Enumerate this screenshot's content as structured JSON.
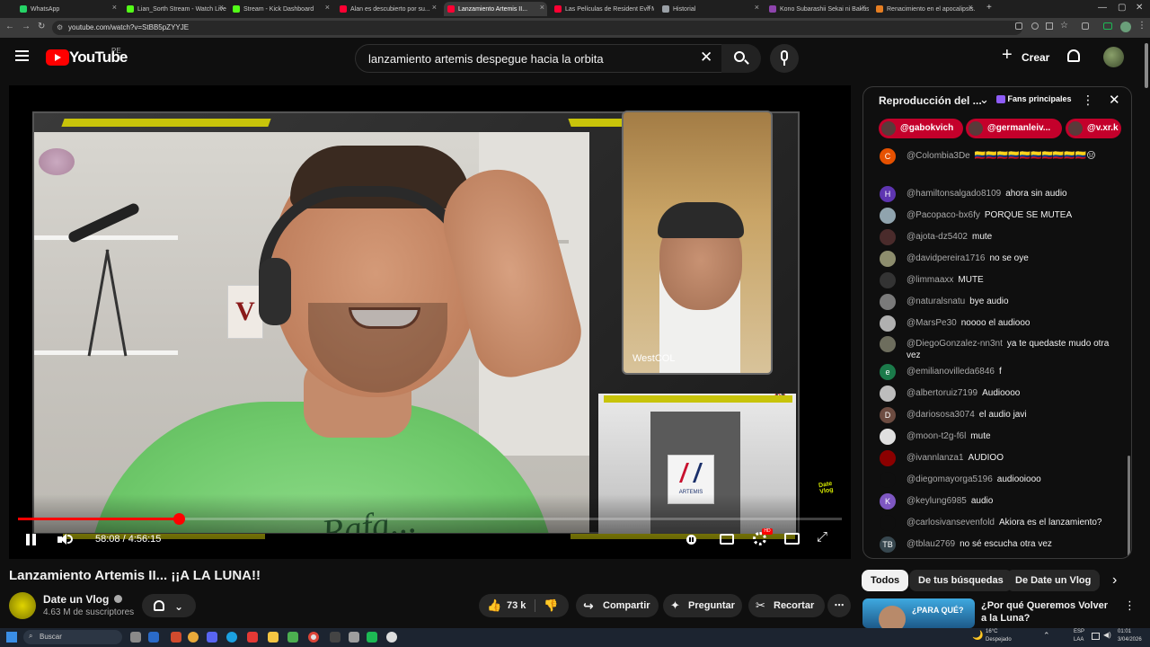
{
  "browser": {
    "tabs": [
      {
        "title": "WhatsApp",
        "color": "#25d366",
        "active": false
      },
      {
        "title": "Lian_Sorth Stream - Watch Live...",
        "color": "#53fc18",
        "active": false
      },
      {
        "title": "Stream - Kick Dashboard",
        "color": "#53fc18",
        "active": false
      },
      {
        "title": "Alan es descubierto por su...",
        "color": "#ff0033",
        "active": false
      },
      {
        "title": "Lanzamiento Artemis II...",
        "color": "#ff0033",
        "active": true
      },
      {
        "title": "Las Películas de Resident Evil M...",
        "color": "#ff0033",
        "active": false
      },
      {
        "title": "Historial",
        "color": "#9aa0a6",
        "active": false
      },
      {
        "title": "Kono Subarashii Sekai ni Bakus...",
        "color": "#8e44ad",
        "active": false
      },
      {
        "title": "Renacimiento en el apocalipsis...",
        "color": "#e67e22",
        "active": false
      }
    ],
    "url": "youtube.com/watch?v=StBB5pZYYJE"
  },
  "header": {
    "logo_text": "YouTube",
    "country": "PE",
    "search_value": "lanzamiento artemis despegue hacia la orbita",
    "create_label": "Crear"
  },
  "player": {
    "time_current": "58:08",
    "time_separator": "/",
    "time_total": "4:56:15",
    "progress_fraction": 0.195,
    "guest_name": "WestCOL",
    "sign_text": "ARTEMIS"
  },
  "video": {
    "title": "Lanzamiento Artemis II... ¡¡A LA LUNA!!",
    "channel": "Date un Vlog",
    "subscribers": "4.63 M de suscriptores",
    "likes": "73 k",
    "share_label": "Compartir",
    "ask_label": "Preguntar",
    "clip_label": "Recortar"
  },
  "chat": {
    "title": "Reproducción del ...",
    "badge": "Fans principales",
    "pinned": [
      "@gabokvich",
      "@germanleiv...",
      "@v.xr.k"
    ],
    "messages": [
      {
        "author": "@Colombia3De",
        "text": "🇨🇴🇨🇴🇨🇴🇨🇴🇨🇴🇨🇴🇨🇴🇨🇴🇨🇴🇨🇴😑",
        "initial": "C",
        "color": "#e65100"
      },
      {
        "author": "@hamiltonsalgado8109",
        "text": "ahora sin audio",
        "initial": "H",
        "color": "#5e35b1"
      },
      {
        "author": "@Pacopaco-bx6fy",
        "text": "PORQUE SE MUTEA",
        "initial": "",
        "color": "#90a4ae"
      },
      {
        "author": "@ajota-dz5402",
        "text": "mute",
        "initial": "",
        "color": "#4a2b2b"
      },
      {
        "author": "@davidpereira1716",
        "text": "no se oye",
        "initial": "",
        "color": "#8d8d6d"
      },
      {
        "author": "@limmaaxx",
        "text": "MUTE",
        "initial": "",
        "color": "#333333"
      },
      {
        "author": "@naturalsnatu",
        "text": "bye audio",
        "initial": "",
        "color": "#7a7a7a"
      },
      {
        "author": "@MarsPe30",
        "text": "noooo el audiooo",
        "initial": "",
        "color": "#b0b0b0"
      },
      {
        "author": "@DiegoGonzalez-nn3nt",
        "text": "ya te quedaste mudo otra vez",
        "initial": "",
        "color": "#6d6d5d"
      },
      {
        "author": "@emilianovilleda6846",
        "text": "f",
        "initial": "e",
        "color": "#1b7a4a"
      },
      {
        "author": "@albertoruiz7199",
        "text": "Audioooo",
        "initial": "",
        "color": "#bdbdbd"
      },
      {
        "author": "@dariososa3074",
        "text": "el audio javi",
        "initial": "D",
        "color": "#6d4c41"
      },
      {
        "author": "@moon-t2g-f6l",
        "text": "mute",
        "initial": "",
        "color": "#e0e0e0"
      },
      {
        "author": "@ivannlanza1",
        "text": "AUDIOO",
        "initial": "",
        "color": "#8b0000"
      },
      {
        "author": "@diegomayorga5196",
        "text": "audiooiooo",
        "initial": "",
        "color": "#0f0f0f"
      },
      {
        "author": "@keylung6985",
        "text": "audio",
        "initial": "K",
        "color": "#7e57c2"
      },
      {
        "author": "@carlosivansevenfold",
        "text": "Akiora es el lanzamiento?",
        "initial": "",
        "color": "#0f0f0f"
      },
      {
        "author": "@tblau2769",
        "text": "no sé escucha otra vez",
        "initial": "TB",
        "color": "#37474f"
      }
    ]
  },
  "chips": {
    "all": "Todos",
    "searches": "De tus búsquedas",
    "channel": "De Date un Vlog"
  },
  "recommendation": {
    "title": "¿Por qué Queremos Volver a la Luna?",
    "thumb_text": "¿PARA QUÉ?"
  },
  "taskbar": {
    "search_label": "Buscar",
    "weather_temp": "16°C",
    "weather_desc": "Despejado",
    "lang": "ESP",
    "lang_sub": "LAA",
    "time": "01:01",
    "date": "3/04/2026"
  }
}
